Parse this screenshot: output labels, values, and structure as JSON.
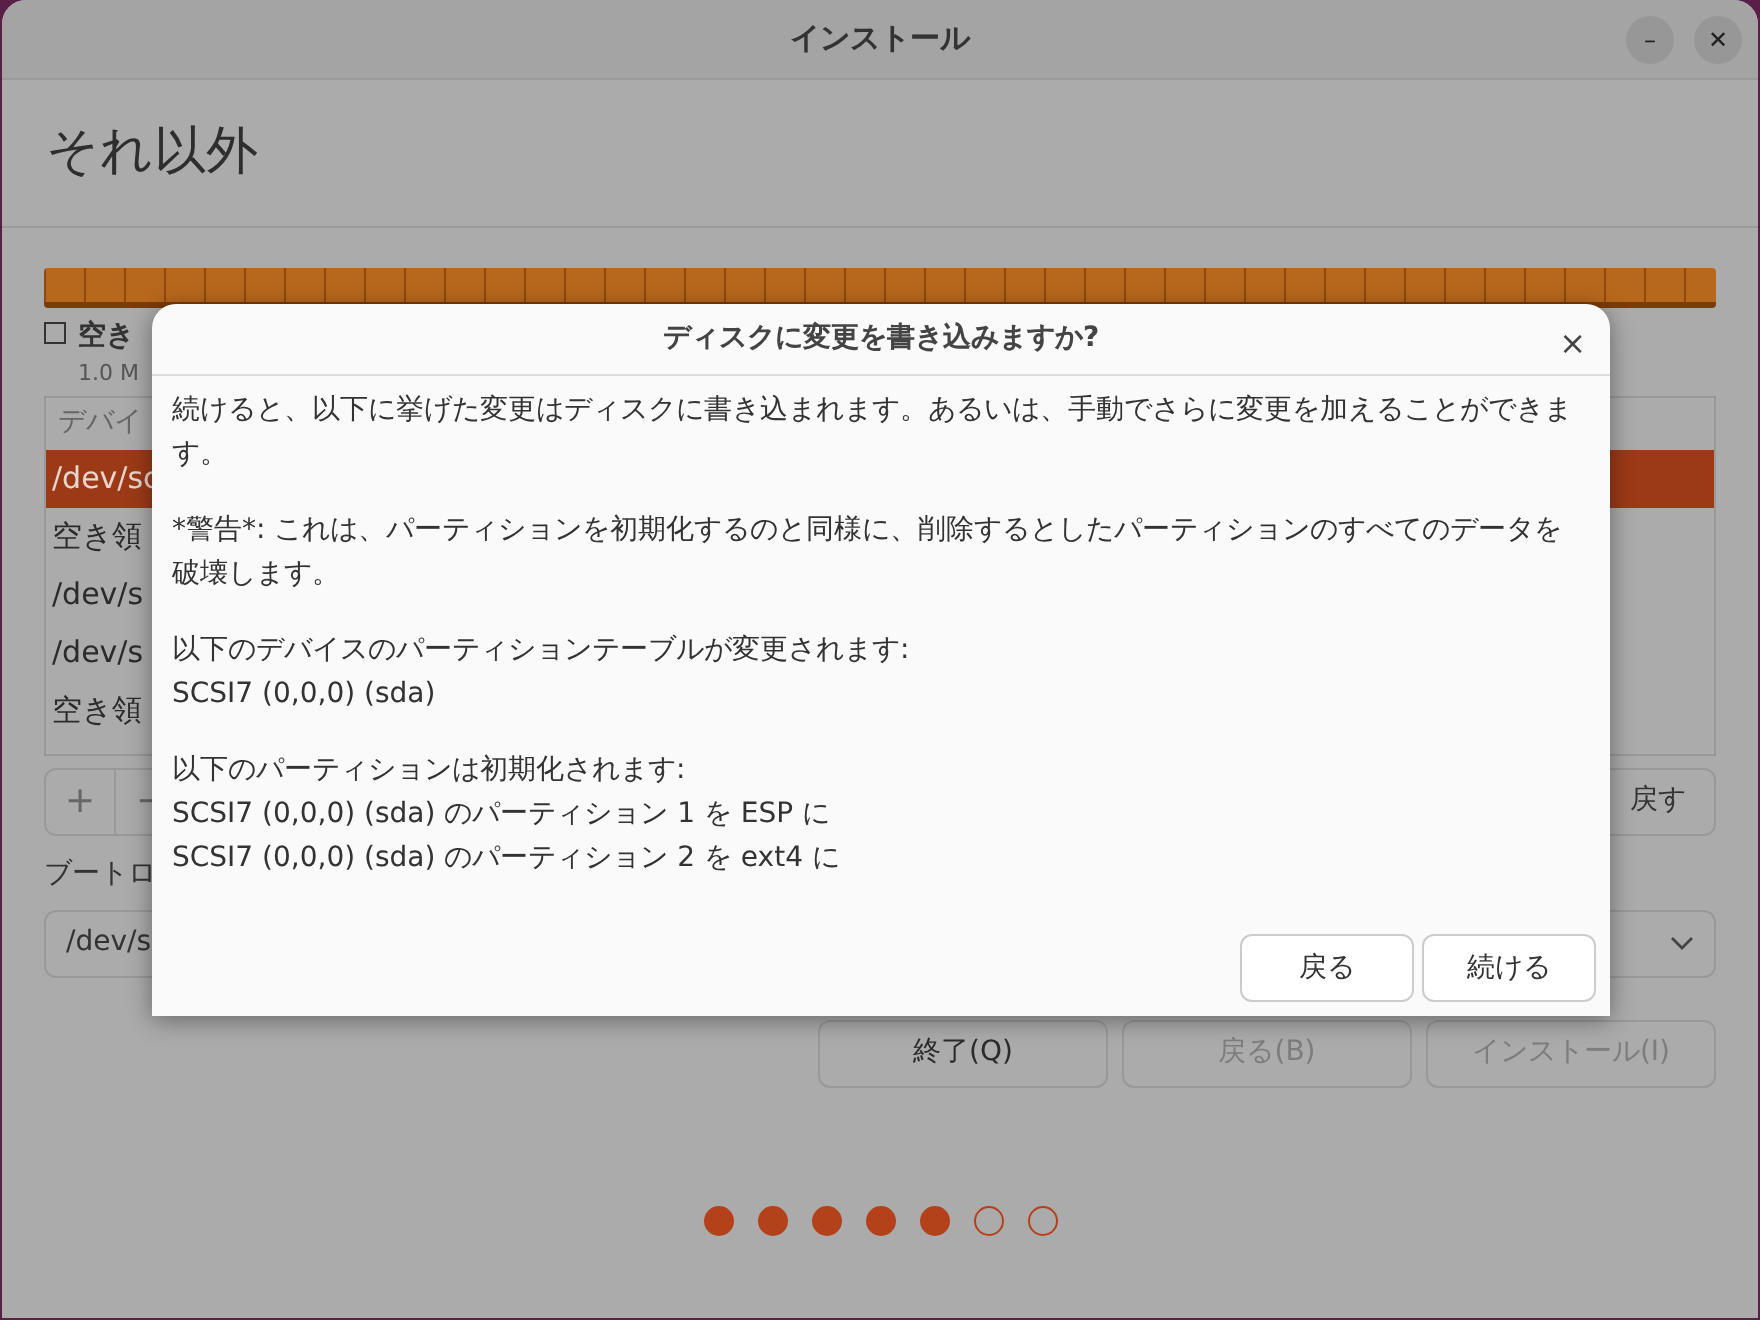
{
  "window": {
    "title": "インストール",
    "controls": [
      "–",
      "✕"
    ]
  },
  "page": {
    "heading": "それ以外",
    "free_space": {
      "label": "空き",
      "checked": false,
      "size": "1.0 M"
    },
    "table": {
      "header": "デバイ",
      "rows": [
        {
          "text": "/dev/sc",
          "selected": true
        },
        {
          "text": "空き領",
          "selected": false
        },
        {
          "text": "/dev/s",
          "selected": false
        },
        {
          "text": "/dev/s",
          "selected": false
        },
        {
          "text": "空き領",
          "selected": false
        }
      ]
    },
    "table_buttons": [
      "+",
      "−"
    ],
    "revert_button": "戻す",
    "bootloader_label": "ブートロ",
    "bootloader_device": "/dev/s",
    "nav_buttons": [
      {
        "label": "終了(Q)",
        "disabled": false
      },
      {
        "label": "戻る(B)",
        "disabled": true
      },
      {
        "label": "インストール(I)",
        "disabled": true
      }
    ],
    "steps": [
      {
        "done": true
      },
      {
        "done": true
      },
      {
        "done": true
      },
      {
        "done": true
      },
      {
        "done": true
      },
      {
        "done": false
      },
      {
        "done": false
      }
    ]
  },
  "dialog": {
    "title": "ディスクに変更を書き込みますか?",
    "close": "×",
    "blocks": [
      [
        "続けると、以下に挙げた変更はディスクに書き込まれます。あるいは、手動でさらに変更を加えることができます。"
      ],
      [
        "*警告*: これは、パーティションを初期化するのと同様に、削除するとしたパーティションのすべてのデータを破壊します。"
      ],
      [
        "以下のデバイスのパーティションテーブルが変更されます:",
        "SCSI7 (0,0,0) (sda)"
      ],
      [
        "以下のパーティションは初期化されます:",
        "SCSI7 (0,0,0) (sda) のパーティション 1 を ESP に",
        "SCSI7 (0,0,0) (sda) のパーティション 2 を ext4 に"
      ]
    ],
    "buttons": [
      "戻る",
      "続ける"
    ]
  }
}
